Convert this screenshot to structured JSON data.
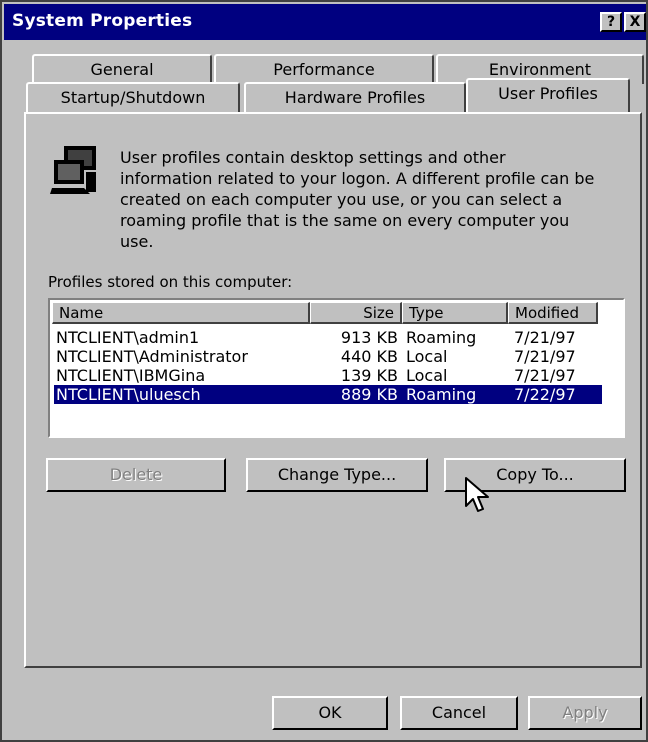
{
  "window": {
    "title": "System Properties",
    "help_glyph": "?",
    "close_glyph": "X"
  },
  "tabs": {
    "back_row": [
      "General",
      "Performance",
      "Environment"
    ],
    "front_row": [
      "Startup/Shutdown",
      "Hardware Profiles",
      "User Profiles"
    ],
    "active": "User Profiles"
  },
  "user_profiles": {
    "description": "User profiles contain desktop settings and other information related to your logon.  A different profile can be created on each computer you use, or you can select a roaming profile that is the same on every computer you use.",
    "list_label": "Profiles stored on this computer:",
    "columns": [
      "Name",
      "Size",
      "Type",
      "Modified"
    ],
    "rows": [
      {
        "name": "NTCLIENT\\admin1",
        "size": "913 KB",
        "type": "Roaming",
        "modified": "7/21/97",
        "selected": false
      },
      {
        "name": "NTCLIENT\\Administrator",
        "size": "440 KB",
        "type": "Local",
        "modified": "7/21/97",
        "selected": false
      },
      {
        "name": "NTCLIENT\\IBMGina",
        "size": "139 KB",
        "type": "Local",
        "modified": "7/21/97",
        "selected": false
      },
      {
        "name": "NTCLIENT\\uluesch",
        "size": "889 KB",
        "type": "Roaming",
        "modified": "7/22/97",
        "selected": true
      }
    ],
    "buttons": {
      "delete": "Delete",
      "change_type": "Change Type...",
      "copy_to": "Copy To..."
    }
  },
  "footer_buttons": {
    "ok": "OK",
    "cancel": "Cancel",
    "apply": "Apply"
  },
  "colors": {
    "titlebar": "#000080",
    "face": "#c0c0c0",
    "selection": "#000080"
  }
}
